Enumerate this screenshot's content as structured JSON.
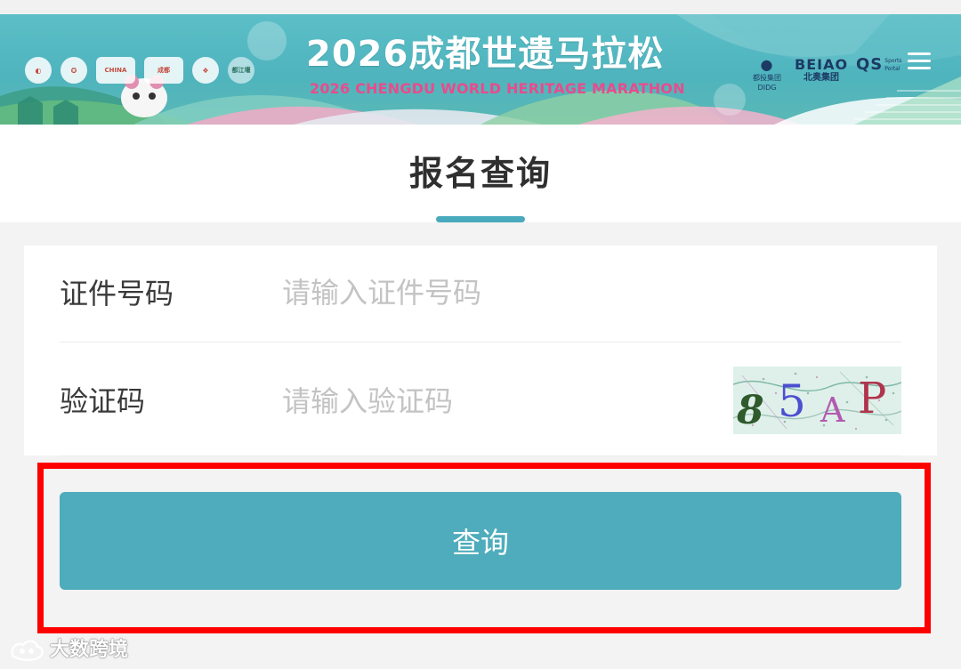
{
  "banner": {
    "title": "2026成都世遗马拉松",
    "subtitle": "2026 CHENGDU WORLD HERITAGE MARATHON",
    "logo_texts": [
      "CHINA",
      "成都",
      "CHENGDU",
      "都江堰"
    ],
    "sponsors": [
      {
        "mark": "●",
        "name": "都投集团",
        "sub": "DIDG"
      },
      {
        "mark": "BEIAO",
        "name": "北奥集团",
        "sub": ""
      },
      {
        "mark": "QS",
        "name": "Sports Portal",
        "sub": ""
      }
    ],
    "menu_icon": "hamburger-menu-icon"
  },
  "page": {
    "title": "报名查询"
  },
  "form": {
    "id_number": {
      "label": "证件号码",
      "placeholder": "请输入证件号码",
      "value": ""
    },
    "captcha": {
      "label": "验证码",
      "placeholder": "请输入验证码",
      "value": "",
      "image_chars": [
        "8",
        "5",
        "A",
        "P"
      ]
    }
  },
  "actions": {
    "submit_label": "查询"
  },
  "watermark": {
    "text": "大数跨境",
    "icon": "dashu-logo-icon"
  },
  "colors": {
    "banner_bg": "#52b6c0",
    "accent": "#4eacbc",
    "highlight": "#ff0000",
    "subtitle": "#e94b8c",
    "page_bg": "#f3f3f3"
  }
}
